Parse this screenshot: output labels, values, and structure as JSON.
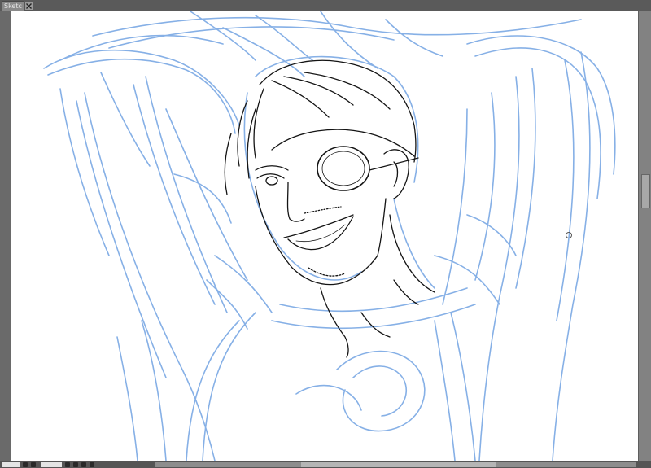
{
  "document_tab": {
    "title": "Sketch.lip",
    "close_icon": "close-icon"
  },
  "canvas": {
    "background": "#ffffff",
    "sketch_color": "#6fa2e0",
    "lineart_color": "#111111"
  },
  "statusbar": {
    "zoom_value": "",
    "angle_value": ""
  }
}
